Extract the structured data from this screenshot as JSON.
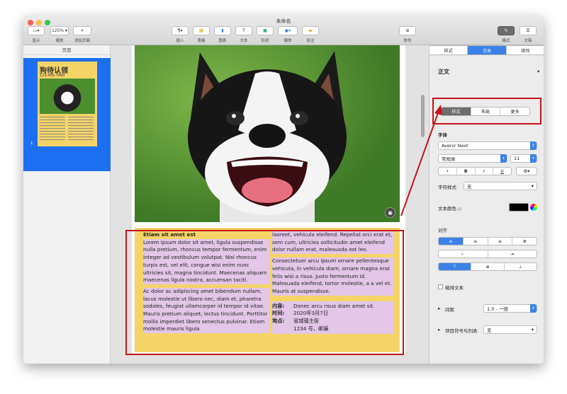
{
  "window": {
    "title": "未命名"
  },
  "toolbar": {
    "left": [
      {
        "name": "display",
        "label": "显示",
        "glyph": "▭▾"
      },
      {
        "name": "zoom",
        "label": "缩放",
        "glyph": "125% ▾"
      },
      {
        "name": "add-page",
        "label": "添加页面",
        "glyph": "+"
      }
    ],
    "center": [
      {
        "name": "insert",
        "label": "插入",
        "glyph": "¶▾"
      },
      {
        "name": "table",
        "label": "表格",
        "glyph": "▦"
      },
      {
        "name": "chart",
        "label": "图表",
        "glyph": "▮"
      },
      {
        "name": "text",
        "label": "文本",
        "glyph": "T"
      },
      {
        "name": "shape",
        "label": "形状",
        "glyph": "■"
      },
      {
        "name": "media",
        "label": "媒体",
        "glyph": "▣▾"
      },
      {
        "name": "comment",
        "label": "批注",
        "glyph": "▬"
      }
    ],
    "collab": {
      "label": "协作",
      "glyph": "⊕"
    },
    "right": [
      {
        "name": "format",
        "label": "格式",
        "glyph": "✎"
      },
      {
        "name": "document",
        "label": "文稿",
        "glyph": "☰"
      }
    ]
  },
  "sidebar": {
    "header": "页面",
    "thumb_title": "狗待认领",
    "thumb_phone": "123-456-7890",
    "page_num": "1"
  },
  "doc": {
    "heading": "Etiam sit amet est",
    "p1": "Lorem ipsum dolor sit amet, ligula suspendisse nulla pretium, rhoncus tempor fermentum, enim integer ad vestibulum volutpat. Nisl rhoncus turpis est, vel elit, congue wisi enim nunc ultricies sit, magna tincidunt. Maecenas aliquam maecenas ligula nostra, accumsan taciti.",
    "p2": "Ac dolor ac adipiscing amet bibendum nullam, lacus molestie ut libero nec, diam et, pharetra sodales, feugiat ullamcorper id tempor id vitae. Mauris pretium aliquet, lectus tincidunt. Porttitor mollis imperdiet libero senectus pulvinar. Etiam molestie mauris ligula",
    "p3": "laoreet, vehicula eleifend. Repellat orci erat et, sem cum, ultricies sollicitudin amet eleifend dolor nullam erat, malesuada est leo.",
    "p4": "Consectetuer arcu ipsum ornare pellentesque vehicula, in vehicula diam, ornare magna erat felis wisi a risus. Justo fermentum id. Malesuada eleifend, tortor molestie, a a vel et. Mauris at suspendisse.",
    "info": [
      {
        "k": "内容:",
        "v": "Donec arcu risus diam amet sit."
      },
      {
        "k": "时间:",
        "v": "2020年3月7日"
      },
      {
        "k": "地点:",
        "v": "省城镇主街"
      },
      {
        "k": "",
        "v": "1234 号，邮编"
      }
    ]
  },
  "inspector": {
    "tabs": [
      "样式",
      "文本",
      "排列"
    ],
    "active_tab": "文本",
    "para_style": "正文",
    "subtabs": [
      "样式",
      "布局",
      "更多"
    ],
    "font_section": "字体",
    "font_name": "Avenir Next",
    "font_weight": "常规体",
    "font_size": "11",
    "bius": [
      "•",
      "B",
      "I",
      "U"
    ],
    "char_style_label": "字符样式",
    "char_style_value": "无",
    "text_color_label": "文本颜色 ◇",
    "align_label": "对齐",
    "indent_glyphs": [
      "⇤",
      "⇥"
    ],
    "shrink_label": "缩排文本",
    "spacing_label": "间距",
    "spacing_value": "1.0 - 一倍",
    "bullets_label": "项目符号与列表",
    "bullets_value": "无",
    "colors": {
      "accent": "#3b82e8",
      "poster": "#f5d467",
      "highlight": "#e3c6e8",
      "annotation": "#c3151a"
    }
  }
}
